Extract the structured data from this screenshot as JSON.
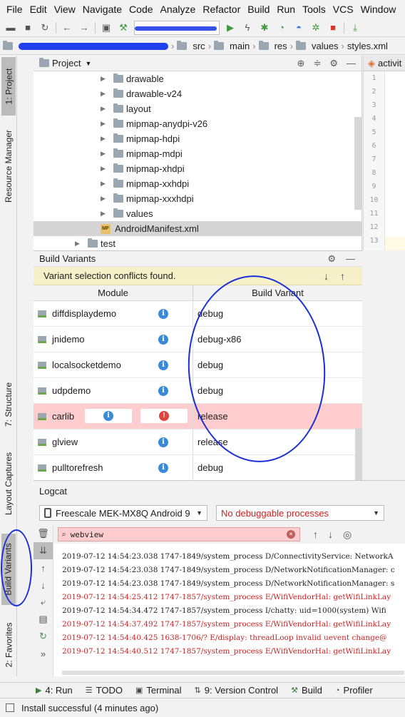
{
  "menu": [
    "File",
    "Edit",
    "View",
    "Navigate",
    "Code",
    "Analyze",
    "Refactor",
    "Build",
    "Run",
    "Tools",
    "VCS",
    "Window"
  ],
  "breadcrumb": [
    "src",
    "main",
    "res",
    "values",
    "styles.xml"
  ],
  "left_tabs": {
    "project": "1: Project",
    "resource_manager": "Resource Manager",
    "structure": "7: Structure",
    "layout_captures": "Layout Captures",
    "build_variants": "Build Variants",
    "favorites": "2: Favorites"
  },
  "project_panel": {
    "title": "Project",
    "tree": [
      {
        "label": "drawable",
        "type": "folder"
      },
      {
        "label": "drawable-v24",
        "type": "folder"
      },
      {
        "label": "layout",
        "type": "folder"
      },
      {
        "label": "mipmap-anydpi-v26",
        "type": "folder"
      },
      {
        "label": "mipmap-hdpi",
        "type": "folder"
      },
      {
        "label": "mipmap-mdpi",
        "type": "folder"
      },
      {
        "label": "mipmap-xhdpi",
        "type": "folder"
      },
      {
        "label": "mipmap-xxhdpi",
        "type": "folder"
      },
      {
        "label": "mipmap-xxxhdpi",
        "type": "folder"
      },
      {
        "label": "values",
        "type": "folder"
      },
      {
        "label": "AndroidManifest.xml",
        "type": "file"
      },
      {
        "label": "test",
        "type": "folder"
      }
    ]
  },
  "editor": {
    "tab": "activit",
    "lines": [
      "1",
      "2",
      "3",
      "4",
      "5",
      "6",
      "7",
      "8",
      "9",
      "10",
      "11",
      "12",
      "13"
    ]
  },
  "build_variants": {
    "title": "Build Variants",
    "warning": "Variant selection conflicts found.",
    "columns": {
      "module": "Module",
      "variant": "Build Variant"
    },
    "rows": [
      {
        "module": "diffdisplaydemo",
        "variant": "debug",
        "error": false
      },
      {
        "module": "jnidemo",
        "variant": "debug-x86",
        "error": false
      },
      {
        "module": "localsocketdemo",
        "variant": "debug",
        "error": false
      },
      {
        "module": "udpdemo",
        "variant": "debug",
        "error": false
      },
      {
        "module": "carlib",
        "variant": "release",
        "error": true
      },
      {
        "module": "glview",
        "variant": "release",
        "error": false
      },
      {
        "module": "pulltorefresh",
        "variant": "debug",
        "error": false
      }
    ]
  },
  "logcat": {
    "title": "Logcat",
    "device": "Freescale MEK-MX8Q Android 9",
    "process": "No debuggable processes",
    "filter": "webview",
    "lines": [
      {
        "level": "D",
        "text": "2019-07-12 14:54:23.038 1747-1849/system_process D/ConnectivityService: NetworkA"
      },
      {
        "level": "D",
        "text": "2019-07-12 14:54:23.038 1747-1849/system_process D/NetworkNotificationManager: c"
      },
      {
        "level": "D",
        "text": "2019-07-12 14:54:23.038 1747-1849/system_process D/NetworkNotificationManager: s"
      },
      {
        "level": "E",
        "text": "2019-07-12 14:54:25.412 1747-1857/system_process E/WifiVendorHal: getWifiLinkLay"
      },
      {
        "level": "I",
        "text": "2019-07-12 14:54:34.472 1747-1857/system_process I/chatty: uid=1000(system) Wifi"
      },
      {
        "level": "E",
        "text": "2019-07-12 14:54:37.492 1747-1857/system_process E/WifiVendorHal: getWifiLinkLay"
      },
      {
        "level": "E",
        "text": "2019-07-12 14:54:40.425 1638-1706/? E/display: threadLoop invalid uevent change@"
      },
      {
        "level": "E",
        "text": "2019-07-12 14:54:40.512 1747-1857/system_process E/WifiVendorHal: getWifiLinkLay"
      }
    ]
  },
  "bottom_tabs": [
    "4: Run",
    "TODO",
    "Terminal",
    "9: Version Control",
    "Build",
    "Profiler"
  ],
  "status": "Install successful (4 minutes ago)"
}
